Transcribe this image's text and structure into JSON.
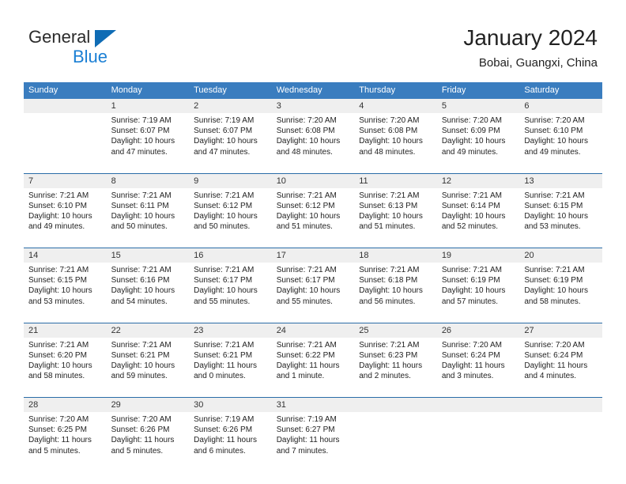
{
  "logo": {
    "word1": "General",
    "word2": "Blue",
    "triangle_color": "#0f6cb5",
    "blue_color": "#1a7fd4"
  },
  "header": {
    "title": "January 2024",
    "subtitle": "Bobai, Guangxi, China",
    "header_bg": "#3a7dbf",
    "separator_color": "#2a6ca8",
    "date_band_bg": "#efefef"
  },
  "weekdays": [
    "Sunday",
    "Monday",
    "Tuesday",
    "Wednesday",
    "Thursday",
    "Friday",
    "Saturday"
  ],
  "weeks": [
    {
      "dates": [
        "",
        "1",
        "2",
        "3",
        "4",
        "5",
        "6"
      ],
      "cells": [
        {
          "empty": true,
          "lines": []
        },
        {
          "empty": false,
          "lines": [
            "Sunrise: 7:19 AM",
            "Sunset: 6:07 PM",
            "Daylight: 10 hours",
            "and 47 minutes."
          ]
        },
        {
          "empty": false,
          "lines": [
            "Sunrise: 7:19 AM",
            "Sunset: 6:07 PM",
            "Daylight: 10 hours",
            "and 47 minutes."
          ]
        },
        {
          "empty": false,
          "lines": [
            "Sunrise: 7:20 AM",
            "Sunset: 6:08 PM",
            "Daylight: 10 hours",
            "and 48 minutes."
          ]
        },
        {
          "empty": false,
          "lines": [
            "Sunrise: 7:20 AM",
            "Sunset: 6:08 PM",
            "Daylight: 10 hours",
            "and 48 minutes."
          ]
        },
        {
          "empty": false,
          "lines": [
            "Sunrise: 7:20 AM",
            "Sunset: 6:09 PM",
            "Daylight: 10 hours",
            "and 49 minutes."
          ]
        },
        {
          "empty": false,
          "lines": [
            "Sunrise: 7:20 AM",
            "Sunset: 6:10 PM",
            "Daylight: 10 hours",
            "and 49 minutes."
          ]
        }
      ]
    },
    {
      "dates": [
        "7",
        "8",
        "9",
        "10",
        "11",
        "12",
        "13"
      ],
      "cells": [
        {
          "empty": false,
          "lines": [
            "Sunrise: 7:21 AM",
            "Sunset: 6:10 PM",
            "Daylight: 10 hours",
            "and 49 minutes."
          ]
        },
        {
          "empty": false,
          "lines": [
            "Sunrise: 7:21 AM",
            "Sunset: 6:11 PM",
            "Daylight: 10 hours",
            "and 50 minutes."
          ]
        },
        {
          "empty": false,
          "lines": [
            "Sunrise: 7:21 AM",
            "Sunset: 6:12 PM",
            "Daylight: 10 hours",
            "and 50 minutes."
          ]
        },
        {
          "empty": false,
          "lines": [
            "Sunrise: 7:21 AM",
            "Sunset: 6:12 PM",
            "Daylight: 10 hours",
            "and 51 minutes."
          ]
        },
        {
          "empty": false,
          "lines": [
            "Sunrise: 7:21 AM",
            "Sunset: 6:13 PM",
            "Daylight: 10 hours",
            "and 51 minutes."
          ]
        },
        {
          "empty": false,
          "lines": [
            "Sunrise: 7:21 AM",
            "Sunset: 6:14 PM",
            "Daylight: 10 hours",
            "and 52 minutes."
          ]
        },
        {
          "empty": false,
          "lines": [
            "Sunrise: 7:21 AM",
            "Sunset: 6:15 PM",
            "Daylight: 10 hours",
            "and 53 minutes."
          ]
        }
      ]
    },
    {
      "dates": [
        "14",
        "15",
        "16",
        "17",
        "18",
        "19",
        "20"
      ],
      "cells": [
        {
          "empty": false,
          "lines": [
            "Sunrise: 7:21 AM",
            "Sunset: 6:15 PM",
            "Daylight: 10 hours",
            "and 53 minutes."
          ]
        },
        {
          "empty": false,
          "lines": [
            "Sunrise: 7:21 AM",
            "Sunset: 6:16 PM",
            "Daylight: 10 hours",
            "and 54 minutes."
          ]
        },
        {
          "empty": false,
          "lines": [
            "Sunrise: 7:21 AM",
            "Sunset: 6:17 PM",
            "Daylight: 10 hours",
            "and 55 minutes."
          ]
        },
        {
          "empty": false,
          "lines": [
            "Sunrise: 7:21 AM",
            "Sunset: 6:17 PM",
            "Daylight: 10 hours",
            "and 55 minutes."
          ]
        },
        {
          "empty": false,
          "lines": [
            "Sunrise: 7:21 AM",
            "Sunset: 6:18 PM",
            "Daylight: 10 hours",
            "and 56 minutes."
          ]
        },
        {
          "empty": false,
          "lines": [
            "Sunrise: 7:21 AM",
            "Sunset: 6:19 PM",
            "Daylight: 10 hours",
            "and 57 minutes."
          ]
        },
        {
          "empty": false,
          "lines": [
            "Sunrise: 7:21 AM",
            "Sunset: 6:19 PM",
            "Daylight: 10 hours",
            "and 58 minutes."
          ]
        }
      ]
    },
    {
      "dates": [
        "21",
        "22",
        "23",
        "24",
        "25",
        "26",
        "27"
      ],
      "cells": [
        {
          "empty": false,
          "lines": [
            "Sunrise: 7:21 AM",
            "Sunset: 6:20 PM",
            "Daylight: 10 hours",
            "and 58 minutes."
          ]
        },
        {
          "empty": false,
          "lines": [
            "Sunrise: 7:21 AM",
            "Sunset: 6:21 PM",
            "Daylight: 10 hours",
            "and 59 minutes."
          ]
        },
        {
          "empty": false,
          "lines": [
            "Sunrise: 7:21 AM",
            "Sunset: 6:21 PM",
            "Daylight: 11 hours",
            "and 0 minutes."
          ]
        },
        {
          "empty": false,
          "lines": [
            "Sunrise: 7:21 AM",
            "Sunset: 6:22 PM",
            "Daylight: 11 hours",
            "and 1 minute."
          ]
        },
        {
          "empty": false,
          "lines": [
            "Sunrise: 7:21 AM",
            "Sunset: 6:23 PM",
            "Daylight: 11 hours",
            "and 2 minutes."
          ]
        },
        {
          "empty": false,
          "lines": [
            "Sunrise: 7:20 AM",
            "Sunset: 6:24 PM",
            "Daylight: 11 hours",
            "and 3 minutes."
          ]
        },
        {
          "empty": false,
          "lines": [
            "Sunrise: 7:20 AM",
            "Sunset: 6:24 PM",
            "Daylight: 11 hours",
            "and 4 minutes."
          ]
        }
      ]
    },
    {
      "dates": [
        "28",
        "29",
        "30",
        "31",
        "",
        "",
        ""
      ],
      "cells": [
        {
          "empty": false,
          "lines": [
            "Sunrise: 7:20 AM",
            "Sunset: 6:25 PM",
            "Daylight: 11 hours",
            "and 5 minutes."
          ]
        },
        {
          "empty": false,
          "lines": [
            "Sunrise: 7:20 AM",
            "Sunset: 6:26 PM",
            "Daylight: 11 hours",
            "and 5 minutes."
          ]
        },
        {
          "empty": false,
          "lines": [
            "Sunrise: 7:19 AM",
            "Sunset: 6:26 PM",
            "Daylight: 11 hours",
            "and 6 minutes."
          ]
        },
        {
          "empty": false,
          "lines": [
            "Sunrise: 7:19 AM",
            "Sunset: 6:27 PM",
            "Daylight: 11 hours",
            "and 7 minutes."
          ]
        },
        {
          "empty": true,
          "lines": []
        },
        {
          "empty": true,
          "lines": []
        },
        {
          "empty": true,
          "lines": []
        }
      ]
    }
  ]
}
